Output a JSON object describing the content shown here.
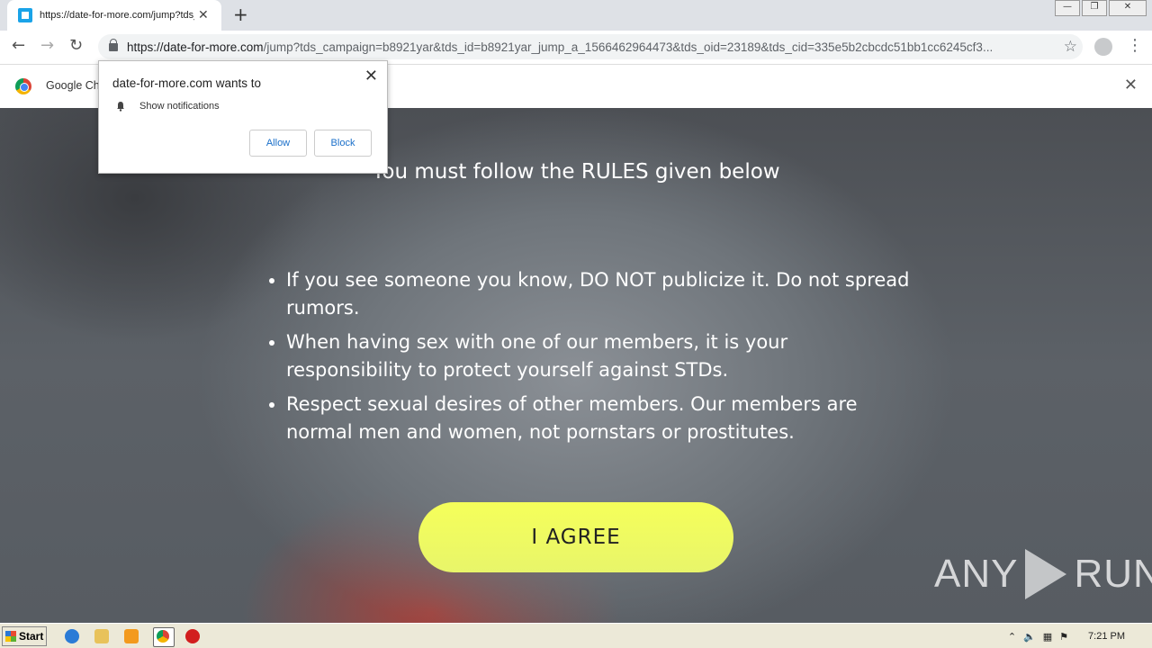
{
  "browser": {
    "tab_title": "https://date-for-more.com/jump?tds_c",
    "url_host": "https://date-for-more.com",
    "url_path": "/jump?tds_campaign=b8921yar&tds_id=b8921yar_jump_a_1566462964473&tds_oid=23189&tds_cid=335e5b2cbcdc51bb1cc6245cf3..."
  },
  "infobar": {
    "text": "Google Ch"
  },
  "popup": {
    "title": "date-for-more.com wants to",
    "permission": "Show notifications",
    "allow_label": "Allow",
    "block_label": "Block"
  },
  "page": {
    "heading": "You must follow the RULES given below",
    "rules": [
      "If you see someone you know, DO NOT publicize it. Do not spread rumors.",
      "When having sex with one of our members, it is your responsibility to protect yourself against STDs.",
      "Respect sexual desires of other members. Our members are normal men and women, not pornstars or prostitutes."
    ],
    "agree_label": "I AGREE",
    "watermark_left": "ANY",
    "watermark_right": "RUN"
  },
  "taskbar": {
    "start_label": "Start",
    "clock": "7:21 PM"
  },
  "colors": {
    "agree_button": "#f0fa5e",
    "link_blue": "#1a6fc9"
  }
}
